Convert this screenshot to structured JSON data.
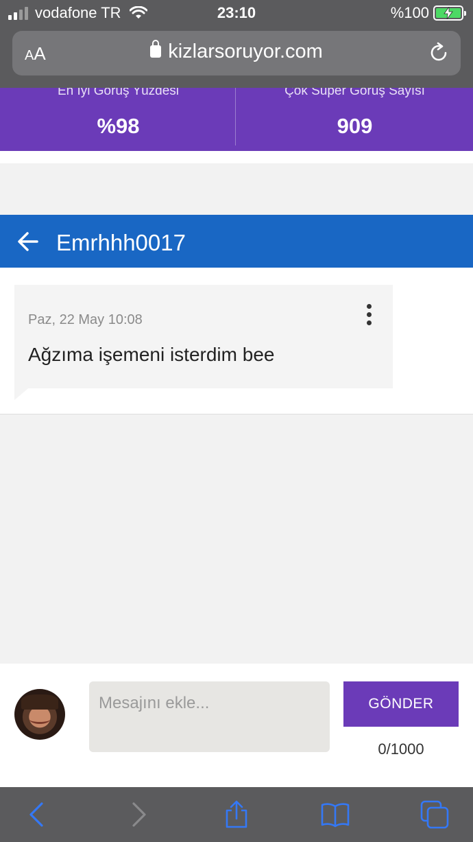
{
  "status_bar": {
    "carrier": "vodafone TR",
    "time": "23:10",
    "battery": "%100"
  },
  "browser": {
    "text_size_small": "A",
    "text_size_large": "A",
    "url": "kizlarsoruyor.com"
  },
  "stats": {
    "left": {
      "label": "En İyi Görüş Yüzdesi",
      "value": "%98"
    },
    "right": {
      "label": "Çok Süper Görüş Sayısı",
      "value": "909"
    }
  },
  "conversation": {
    "title": "Emrhhh0017",
    "messages": [
      {
        "time": "Paz, 22 May 10:08",
        "text": "Ağzıma işemeni isterdim bee"
      }
    ]
  },
  "composer": {
    "placeholder": "Mesajını ekle...",
    "value": "",
    "send_label": "GÖNDER",
    "counter": "0/1000"
  },
  "colors": {
    "purple": "#6b3bb8",
    "blue_header": "#1967c4",
    "ios_blue": "#3478f6",
    "battery_green": "#4cd964"
  },
  "icons": [
    "back-arrow-icon",
    "more-vert-icon",
    "reload-icon",
    "lock-icon",
    "wifi-icon",
    "chevron-left-icon",
    "chevron-right-icon",
    "share-icon",
    "bookmarks-icon",
    "tabs-icon"
  ]
}
